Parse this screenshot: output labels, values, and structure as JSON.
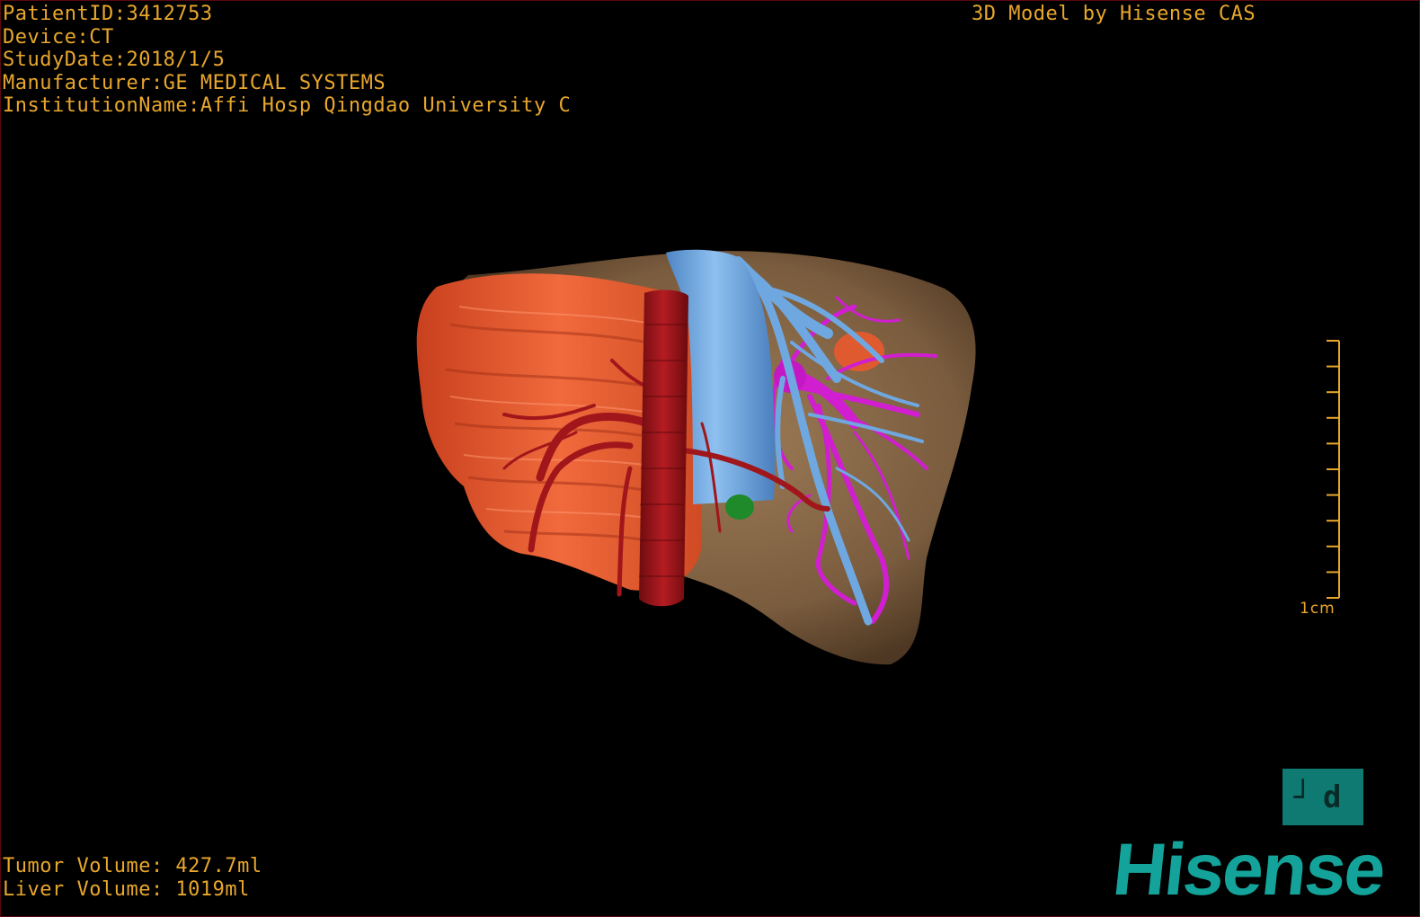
{
  "patient_info": {
    "patient_id": "PatientID:3412753",
    "device": "Device:CT",
    "study_date": "StudyDate:2018/1/5",
    "manufacturer": "Manufacturer:GE MEDICAL SYSTEMS",
    "institution": "InstitutionName:Affi Hosp Qingdao University C"
  },
  "model_credit": "3D Model by Hisense CAS",
  "volumes": {
    "tumor": "Tumor Volume: 427.7ml",
    "liver": "Liver Volume: 1019ml"
  },
  "scale_bar": {
    "label": "1cm",
    "tick_count": 10
  },
  "orientation_marker": "┘d",
  "brand": "Hisense",
  "colors": {
    "overlay_text": "#e8a72c",
    "liver": "#8a6a48",
    "tumor": "#e8552e",
    "hepatic_artery": "#a0161b",
    "vena_cava": "#6fa8e0",
    "portal_vein": "#d01ed0",
    "gallbladder": "#1e8a2a",
    "brand": "#14a39a"
  }
}
